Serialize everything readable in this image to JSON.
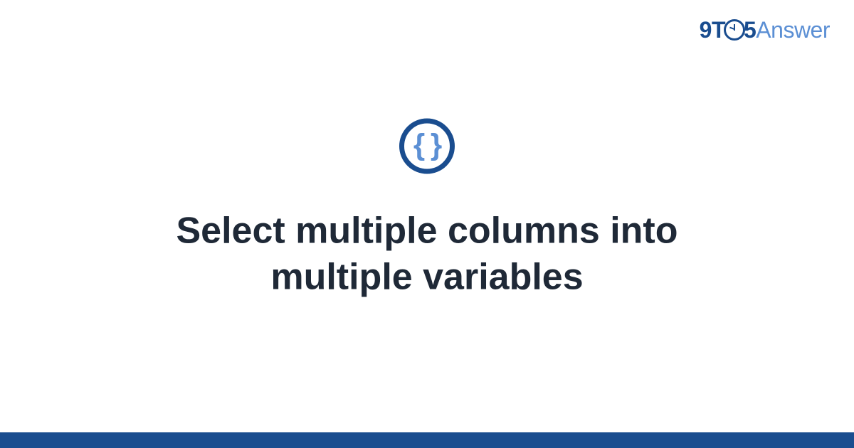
{
  "brand": {
    "part1": "9T",
    "part2": "5",
    "part3": "Answer"
  },
  "icon": {
    "glyph": "{ }"
  },
  "title": "Select multiple columns into multiple variables"
}
